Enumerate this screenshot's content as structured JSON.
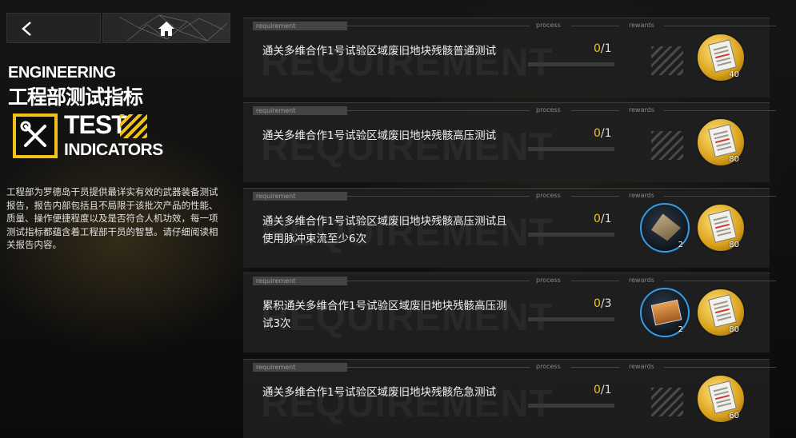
{
  "header": {
    "back_icon": "chevron-left-icon",
    "home_icon": "home-icon"
  },
  "left_panel": {
    "eng_title": "ENGINEERING",
    "cn_title": "工程部测试指标",
    "test_label": "TEST",
    "indicators_label": "INDICATORS",
    "badge_icon": "wrench-screwdriver-icon",
    "description": "工程部为罗德岛干员提供最详实有效的武器装备测试报告，报告内部包括且不局限于该批次产品的性能、质量、操作便捷程度以及是否符合人机功效，每一项测试指标都蕴含着工程部干员的智慧。请仔细阅读相关报告内容。"
  },
  "card_labels": {
    "requirement": "requirement",
    "process": "process",
    "rewards": "rewards",
    "watermark": "REQUIREMENT"
  },
  "tasks": [
    {
      "text": "通关多维合作1号试验区域废旧地块残骸普通测试",
      "current": "0",
      "total": "/1",
      "progress": 0,
      "rewards": [
        {
          "kind": "report",
          "count": "40"
        }
      ]
    },
    {
      "text": "通关多维合作1号试验区域废旧地块残骸高压测试",
      "current": "0",
      "total": "/1",
      "progress": 0,
      "rewards": [
        {
          "kind": "report",
          "count": "80"
        }
      ]
    },
    {
      "text": "通关多维合作1号试验区域废旧地块残骸高压测试且使用脉冲束流至少6次",
      "current": "0",
      "total": "/1",
      "progress": 0,
      "rewards": [
        {
          "kind": "material",
          "count": "2"
        },
        {
          "kind": "report",
          "count": "80"
        }
      ]
    },
    {
      "text": "累积通关多维合作1号试验区域废旧地块残骸高压测试3次",
      "current": "0",
      "total": "/3",
      "progress": 0,
      "rewards": [
        {
          "kind": "box",
          "count": "2"
        },
        {
          "kind": "report",
          "count": "80"
        }
      ]
    },
    {
      "text": "通关多维合作1号试验区域废旧地块残骸危急测试",
      "current": "0",
      "total": "/1",
      "progress": 0,
      "rewards": [
        {
          "kind": "report",
          "count": "60"
        }
      ]
    }
  ],
  "colors": {
    "accent": "#f2c21b",
    "panel": "#202020"
  }
}
